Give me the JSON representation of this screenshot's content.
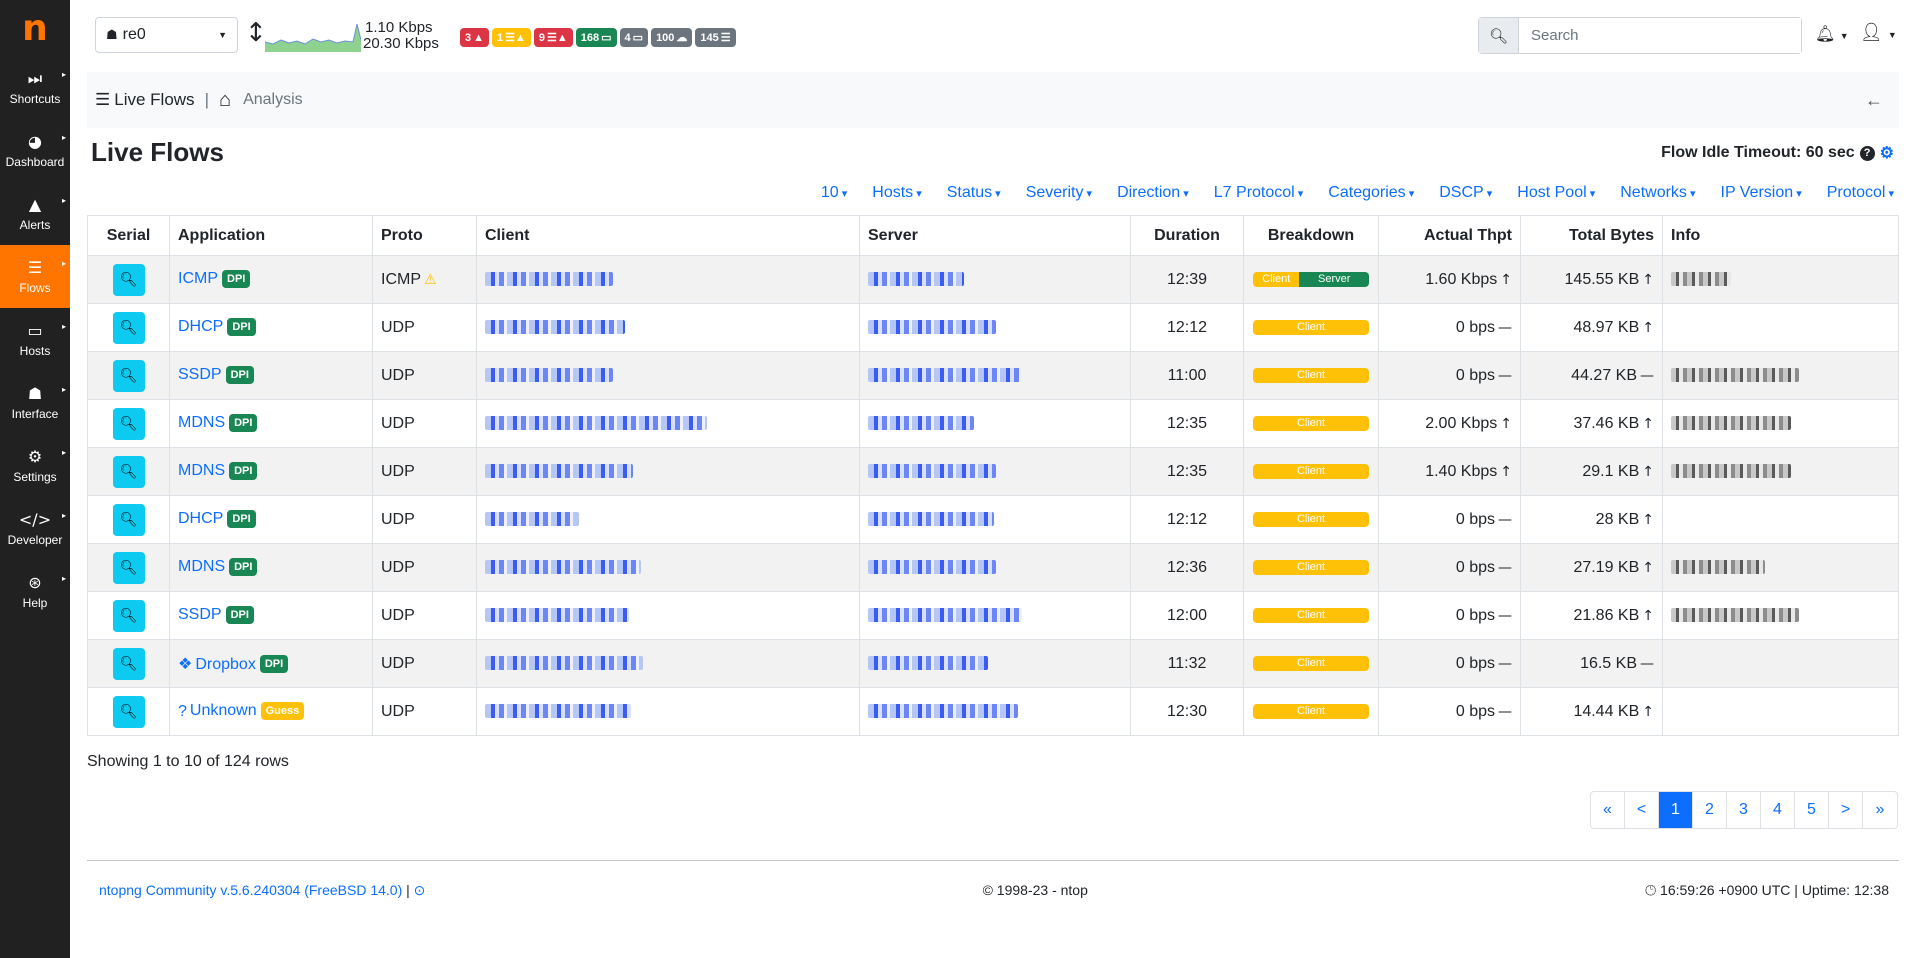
{
  "brand": {
    "logo_letter": "n"
  },
  "sidebar": {
    "items": [
      {
        "label": "Shortcuts",
        "icon": "⏭",
        "icon_name": "fast-forward-icon"
      },
      {
        "label": "Dashboard",
        "icon": "◕",
        "icon_name": "gauge-icon"
      },
      {
        "label": "Alerts",
        "icon": "▲",
        "icon_name": "warning-icon"
      },
      {
        "label": "Flows",
        "icon": "☰",
        "icon_name": "stream-icon"
      },
      {
        "label": "Hosts",
        "icon": "▭",
        "icon_name": "laptop-icon"
      },
      {
        "label": "Interface",
        "icon": "☗",
        "icon_name": "ethernet-icon"
      },
      {
        "label": "Settings",
        "icon": "⚙",
        "icon_name": "gear-icon"
      },
      {
        "label": "Developer",
        "icon": "</>",
        "icon_name": "code-icon"
      },
      {
        "label": "Help",
        "icon": "⊛",
        "icon_name": "lifebuoy-icon"
      }
    ],
    "active": "Flows"
  },
  "topbar": {
    "interface": "re0",
    "traffic_up": "1.10 Kbps",
    "traffic_down": "20.30 Kbps",
    "badges": [
      {
        "text": "3",
        "icon": "▲",
        "color": "red"
      },
      {
        "text": "1",
        "icon": "☰▲",
        "color": "yellow"
      },
      {
        "text": "9",
        "icon": "☰▲",
        "color": "red"
      },
      {
        "text": "168",
        "icon": "▭",
        "color": "green"
      },
      {
        "text": "4",
        "icon": "▭",
        "color": "gray"
      },
      {
        "text": "100",
        "icon": "☁",
        "color": "gray"
      },
      {
        "text": "145",
        "icon": "☰",
        "color": "gray"
      }
    ],
    "search_placeholder": "Search"
  },
  "breadcrumb": {
    "section": "Live Flows",
    "page": "Analysis"
  },
  "page": {
    "title": "Live Flows",
    "idle_timeout": "Flow Idle Timeout: 60 sec"
  },
  "filters": [
    "10",
    "Hosts",
    "Status",
    "Severity",
    "Direction",
    "L7 Protocol",
    "Categories",
    "DSCP",
    "Host Pool",
    "Networks",
    "IP Version",
    "Protocol"
  ],
  "table": {
    "columns": [
      "Serial",
      "Application",
      "Proto",
      "Client",
      "Server",
      "Duration",
      "Breakdown",
      "Actual Thpt",
      "Total Bytes",
      "Info"
    ],
    "rows": [
      {
        "app": "ICMP",
        "tag": "DPI",
        "proto": "ICMP",
        "proto_warn": true,
        "duration": "12:39",
        "breakdown": "both",
        "thpt": "1.60 Kbps",
        "thpt_dir": "↑",
        "bytes": "145.55 KB",
        "bytes_dir": "↑",
        "info": true
      },
      {
        "app": "DHCP",
        "tag": "DPI",
        "proto": "UDP",
        "duration": "12:12",
        "breakdown": "client",
        "thpt": "0 bps",
        "thpt_dir": "—",
        "bytes": "48.97 KB",
        "bytes_dir": "↑",
        "info": false
      },
      {
        "app": "SSDP",
        "tag": "DPI",
        "proto": "UDP",
        "duration": "11:00",
        "breakdown": "client",
        "thpt": "0 bps",
        "thpt_dir": "—",
        "bytes": "44.27 KB",
        "bytes_dir": "—",
        "info": true
      },
      {
        "app": "MDNS",
        "tag": "DPI",
        "proto": "UDP",
        "duration": "12:35",
        "breakdown": "client",
        "thpt": "2.00 Kbps",
        "thpt_dir": "↑",
        "bytes": "37.46 KB",
        "bytes_dir": "↑",
        "info": true
      },
      {
        "app": "MDNS",
        "tag": "DPI",
        "proto": "UDP",
        "duration": "12:35",
        "breakdown": "client",
        "thpt": "1.40 Kbps",
        "thpt_dir": "↑",
        "bytes": "29.1 KB",
        "bytes_dir": "↑",
        "info": true
      },
      {
        "app": "DHCP",
        "tag": "DPI",
        "proto": "UDP",
        "duration": "12:12",
        "breakdown": "client",
        "thpt": "0 bps",
        "thpt_dir": "—",
        "bytes": "28 KB",
        "bytes_dir": "↑",
        "info": false
      },
      {
        "app": "MDNS",
        "tag": "DPI",
        "proto": "UDP",
        "duration": "12:36",
        "breakdown": "client",
        "thpt": "0 bps",
        "thpt_dir": "—",
        "bytes": "27.19 KB",
        "bytes_dir": "↑",
        "info": true
      },
      {
        "app": "SSDP",
        "tag": "DPI",
        "proto": "UDP",
        "duration": "12:00",
        "breakdown": "client",
        "thpt": "0 bps",
        "thpt_dir": "—",
        "bytes": "21.86 KB",
        "bytes_dir": "↑",
        "info": true
      },
      {
        "app": "Dropbox",
        "app_icon": "dropbox-icon",
        "tag": "DPI",
        "proto": "UDP",
        "duration": "11:32",
        "breakdown": "client",
        "thpt": "0 bps",
        "thpt_dir": "—",
        "bytes": "16.5 KB",
        "bytes_dir": "—",
        "info": false
      },
      {
        "app": "Unknown",
        "app_icon": "question-icon",
        "tag": "Guess",
        "proto": "UDP",
        "duration": "12:30",
        "breakdown": "client",
        "thpt": "0 bps",
        "thpt_dir": "—",
        "bytes": "14.44 KB",
        "bytes_dir": "↑",
        "info": false
      }
    ],
    "breakdown_labels": {
      "client": "Client",
      "server": "Server"
    }
  },
  "showing": "Showing 1 to 10 of 124 rows",
  "pagination": [
    "«",
    "<",
    "1",
    "2",
    "3",
    "4",
    "5",
    ">",
    "»"
  ],
  "pagination_current": "1",
  "footer": {
    "version": "ntopng Community v.5.6.240304 (FreeBSD 14.0)",
    "copyright": "© 1998-23 - ntop",
    "status": "16:59:26 +0900 UTC | Uptime: 12:38"
  },
  "colors": {
    "accent": "#ff7500",
    "link": "#0d6efd",
    "client": "#ffc107",
    "server": "#198754"
  }
}
